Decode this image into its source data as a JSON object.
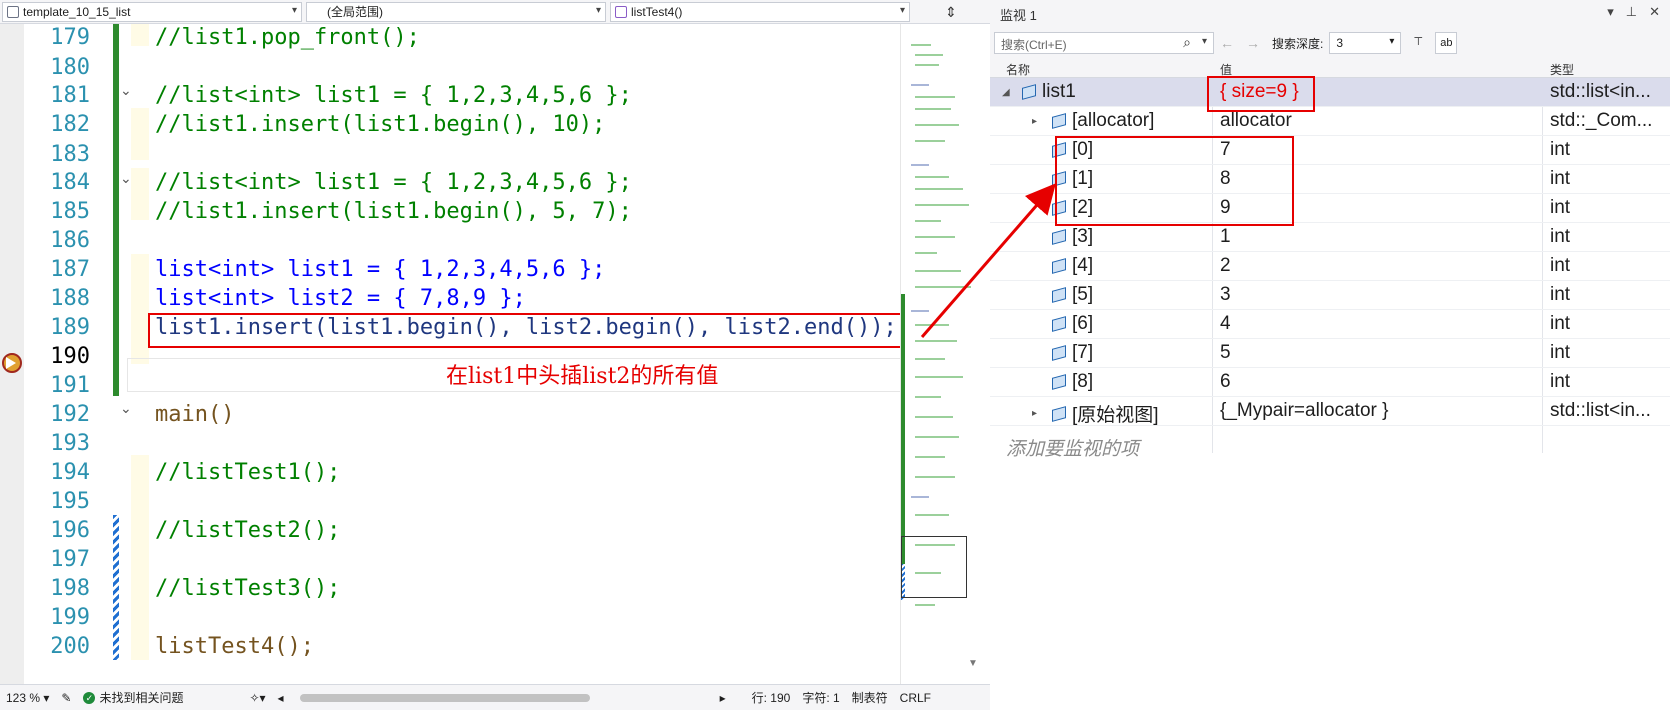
{
  "editor": {
    "file_dropdown": "template_10_15_list",
    "scope_dropdown": "(全局范围)",
    "function_dropdown": "listTest4()",
    "lines": [
      {
        "no": "179",
        "text": "//list1.pop_front();"
      },
      {
        "no": "180",
        "text": ""
      },
      {
        "no": "181",
        "text": "//list<int> list1 = { 1,2,3,4,5,6 };"
      },
      {
        "no": "182",
        "text": "//list1.insert(list1.begin(), 10);"
      },
      {
        "no": "183",
        "text": ""
      },
      {
        "no": "184",
        "text": "//list<int> list1 = { 1,2,3,4,5,6 };"
      },
      {
        "no": "185",
        "text": "//list1.insert(list1.begin(), 5, 7);"
      },
      {
        "no": "186",
        "text": ""
      },
      {
        "no": "187",
        "text": "list<int> list1 = { 1,2,3,4,5,6 };"
      },
      {
        "no": "188",
        "text": "list<int> list2 = { 7,8,9 };"
      },
      {
        "no": "189",
        "text": "list1.insert(list1.begin(), list2.begin(), list2.end());"
      },
      {
        "no": "190",
        "text": ""
      },
      {
        "no": "191",
        "text": ""
      },
      {
        "no": "192",
        "text": "main()"
      },
      {
        "no": "193",
        "text": ""
      },
      {
        "no": "194",
        "text": "//listTest1();"
      },
      {
        "no": "195",
        "text": ""
      },
      {
        "no": "196",
        "text": "//listTest2();"
      },
      {
        "no": "197",
        "text": ""
      },
      {
        "no": "198",
        "text": "//listTest3();"
      },
      {
        "no": "199",
        "text": ""
      },
      {
        "no": "200",
        "text": "listTest4();"
      }
    ],
    "annotation": "在list1中头插list2的所有值",
    "status": {
      "zoom": "123 %",
      "issues": "未找到相关问题",
      "line": "行: 190",
      "char": "字符: 1",
      "tabs": "制表符",
      "eol": "CRLF"
    }
  },
  "watch": {
    "title": "监视 1",
    "search_placeholder": "搜索(Ctrl+E)",
    "depth_label": "搜索深度:",
    "depth_value": "3",
    "columns": {
      "name": "名称",
      "value": "值",
      "type": "类型"
    },
    "rows": [
      {
        "name": "list1",
        "value": "{ size=9 }",
        "type": "std::list<in..."
      },
      {
        "name": "[allocator]",
        "value": "allocator",
        "type": "std::_Com..."
      },
      {
        "name": "[0]",
        "value": "7",
        "type": "int"
      },
      {
        "name": "[1]",
        "value": "8",
        "type": "int"
      },
      {
        "name": "[2]",
        "value": "9",
        "type": "int"
      },
      {
        "name": "[3]",
        "value": "1",
        "type": "int"
      },
      {
        "name": "[4]",
        "value": "2",
        "type": "int"
      },
      {
        "name": "[5]",
        "value": "3",
        "type": "int"
      },
      {
        "name": "[6]",
        "value": "4",
        "type": "int"
      },
      {
        "name": "[7]",
        "value": "5",
        "type": "int"
      },
      {
        "name": "[8]",
        "value": "6",
        "type": "int"
      },
      {
        "name": "[原始视图]",
        "value": "{_Mypair=allocator }",
        "type": "std::list<in..."
      }
    ],
    "add_watch": "添加要监视的项"
  },
  "colors": {
    "highlight_red": "#e60000",
    "comment_green": "#008000",
    "keyword_blue": "#0000ff",
    "type_teal": "#2b91af"
  }
}
